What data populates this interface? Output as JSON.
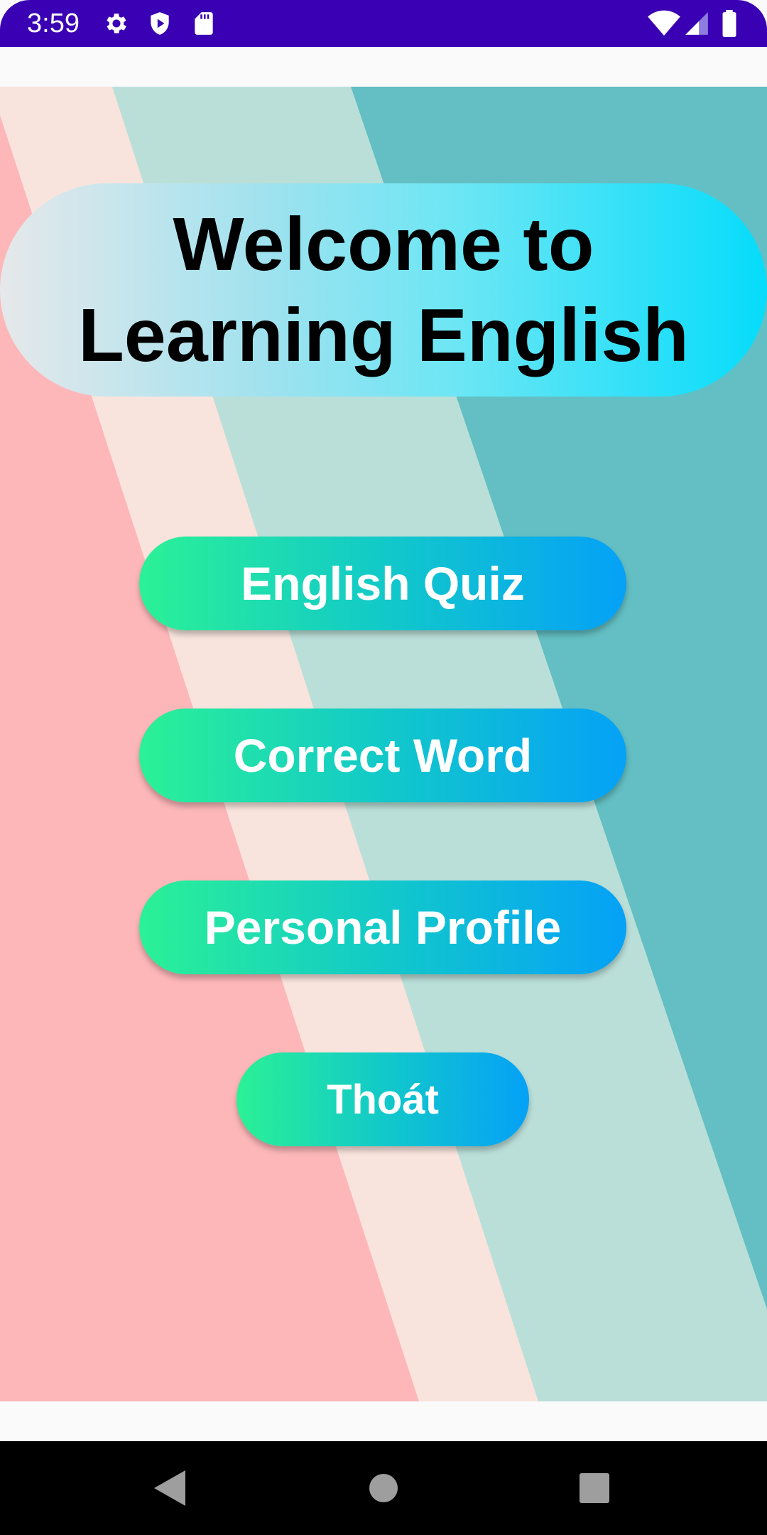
{
  "status_bar": {
    "time": "3:59",
    "icons_left": [
      "settings-gear-icon",
      "play-protect-shield-icon",
      "sd-card-icon"
    ],
    "icons_right": [
      "wifi-icon",
      "cellular-signal-icon",
      "battery-icon"
    ],
    "background_color": "#3a00b3"
  },
  "title": {
    "text": "Welcome to\nLearning English"
  },
  "menu": {
    "english_quiz": "English Quiz",
    "correct_word": "Correct Word",
    "personal_profile": "Personal Profile",
    "exit": "Thoát"
  },
  "colors": {
    "button_gradient_start": "#2bf196",
    "button_gradient_end": "#05a1f7",
    "banner_gradient_start": "#e6e8ea",
    "banner_gradient_end": "#06dcfb",
    "stripe_pink": "#fdb7b9",
    "stripe_cream": "#f9e4dd",
    "stripe_mint": "#badfd8",
    "stripe_teal": "#63bfc3"
  },
  "nav_bar": {
    "buttons": [
      "back-triangle-icon",
      "home-circle-icon",
      "recents-square-icon"
    ]
  }
}
